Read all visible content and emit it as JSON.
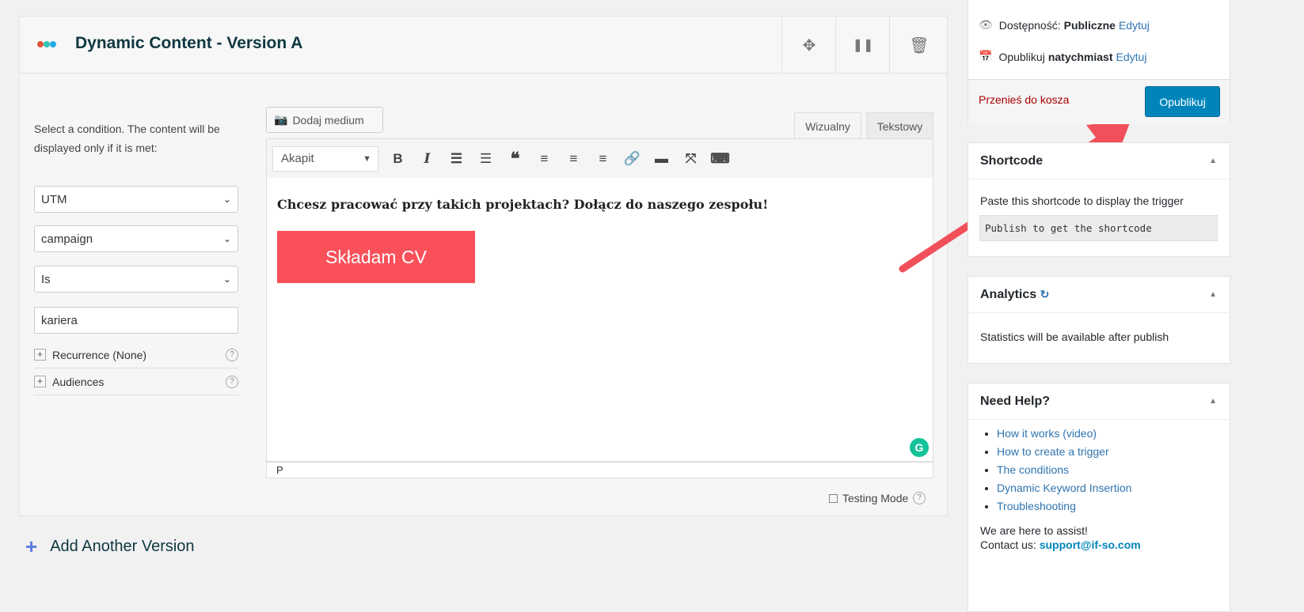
{
  "version_panel": {
    "title": "Dynamic Content - Version A",
    "dot_colors": [
      "#e2533b",
      "#2ec4b6",
      "#23a9e1"
    ],
    "icons": [
      "move-icon",
      "pause-icon",
      "trash-icon"
    ]
  },
  "conditions": {
    "description": "Select a condition. The content will be displayed only if it is met:",
    "selects": [
      "UTM",
      "campaign",
      "Is"
    ],
    "value_input": "kariera",
    "options": [
      {
        "label": "Recurrence (None)"
      },
      {
        "label": "Audiences"
      }
    ]
  },
  "editor": {
    "add_media": "Dodaj medium",
    "tabs": [
      "Wizualny",
      "Tekstowy"
    ],
    "active_tab": "Wizualny",
    "format": "Akapit",
    "content_heading": "Chcesz pracować przy takich projektach? Dołącz do naszego zespołu!",
    "cta_button": "Składam CV",
    "cta_color": "#f9505a",
    "status_path": "P",
    "testing_mode": "Testing Mode"
  },
  "add_version": "Add Another Version",
  "publish": {
    "visibility_label": "Dostępność:",
    "visibility_value": "Publiczne",
    "publish_label": "Opublikuj",
    "publish_value": "natychmiast",
    "edit": "Edytuj",
    "trash": "Przenieś do kosza",
    "publish_button": "Opublikuj"
  },
  "shortcode": {
    "title": "Shortcode",
    "text": "Paste this shortcode to display the trigger",
    "value": "Publish to get the shortcode"
  },
  "analytics": {
    "title": "Analytics",
    "text": "Statistics will be available after publish"
  },
  "help": {
    "title": "Need Help?",
    "links": [
      "How it works (video)",
      "How to create a trigger",
      "The conditions",
      "Dynamic Keyword Insertion",
      "Troubleshooting"
    ],
    "assist": "We are here to assist!",
    "contact_label": "Contact us:",
    "email": "support@if-so.com"
  }
}
